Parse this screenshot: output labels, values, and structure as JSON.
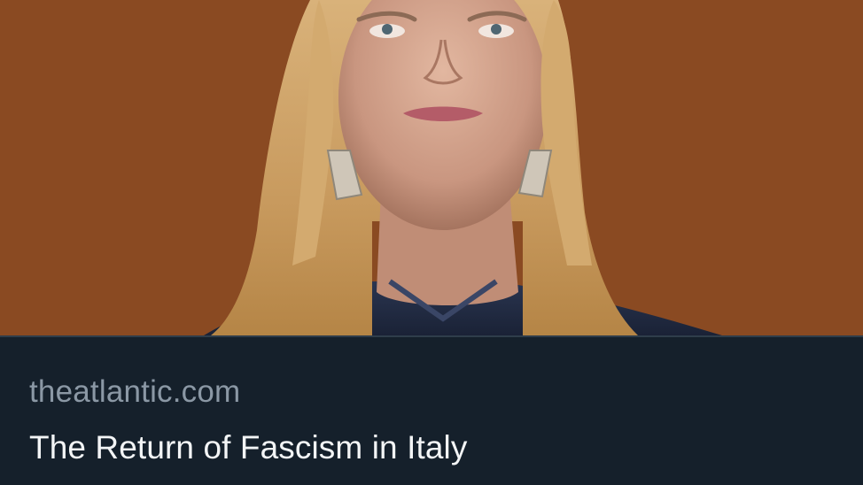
{
  "link_card": {
    "image": {
      "icon": "portrait-photo",
      "background_color": "#8a4a22"
    },
    "domain": "theatlantic.com",
    "title": "The Return of Fascism in Italy"
  },
  "colors": {
    "card_background": "#15202b",
    "domain_text": "#8b98a5",
    "title_text": "#f3f5f6"
  }
}
